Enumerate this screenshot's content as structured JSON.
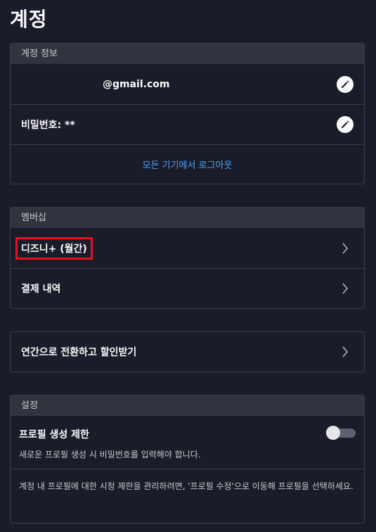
{
  "page": {
    "title": "계정"
  },
  "account_info": {
    "header": "계정 정보",
    "email": "@gmail.com",
    "password": "비밀번호: **",
    "logout_all": "모든 기기에서 로그아웃"
  },
  "membership": {
    "header": "멤버십",
    "plan": "디즈니+ (월간)",
    "billing": "결제 내역"
  },
  "promo": {
    "label": "연간으로 전환하고 할인받기"
  },
  "settings": {
    "header": "설정",
    "profile_limit_title": "프로필 생성 제한",
    "profile_limit_desc": "새로운 프로필 생성 시 비밀번호를 입력해야 합니다.",
    "profile_limit_enabled": false,
    "note": "계정 내 프로필에 대한 시청 제한을 관리하려면, '프로필 수정'으로 이동해 프로필을 선택하세요."
  },
  "colors": {
    "background": "#1a1c29",
    "card_header": "#31343e",
    "link": "#4ea6f6",
    "highlight": "#e8101f"
  },
  "icons": {
    "edit": "pencil-icon",
    "chevron": "chevron-right-icon"
  }
}
